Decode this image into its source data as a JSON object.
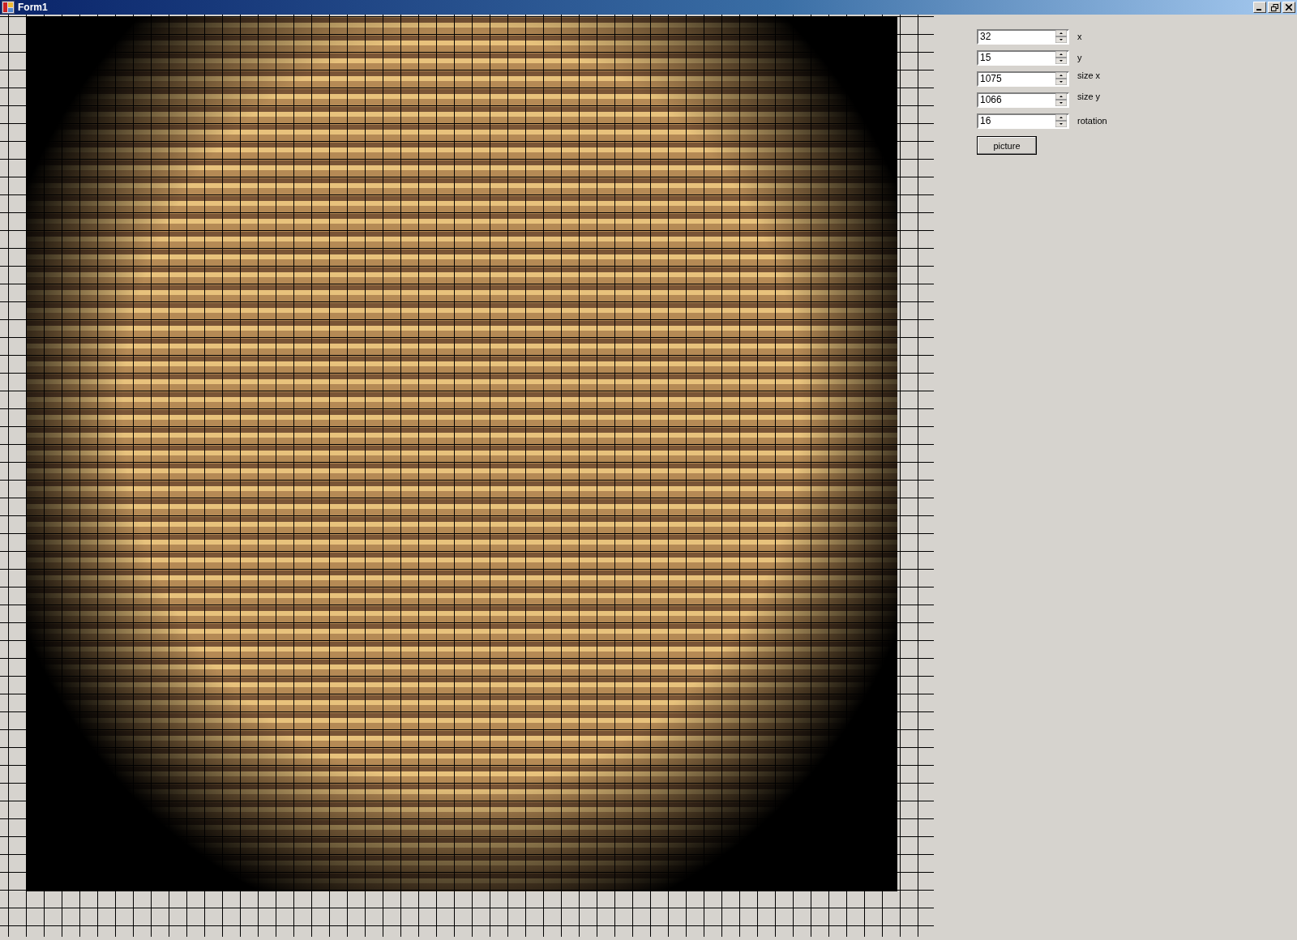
{
  "window": {
    "title": "Form1"
  },
  "fields": [
    {
      "label": "x",
      "value": "32"
    },
    {
      "label": "y",
      "value": "15"
    },
    {
      "label": "size x",
      "value": "1075"
    },
    {
      "label": "size y",
      "value": "1066"
    },
    {
      "label": "rotation",
      "value": "16"
    }
  ],
  "button": {
    "label": "picture"
  }
}
